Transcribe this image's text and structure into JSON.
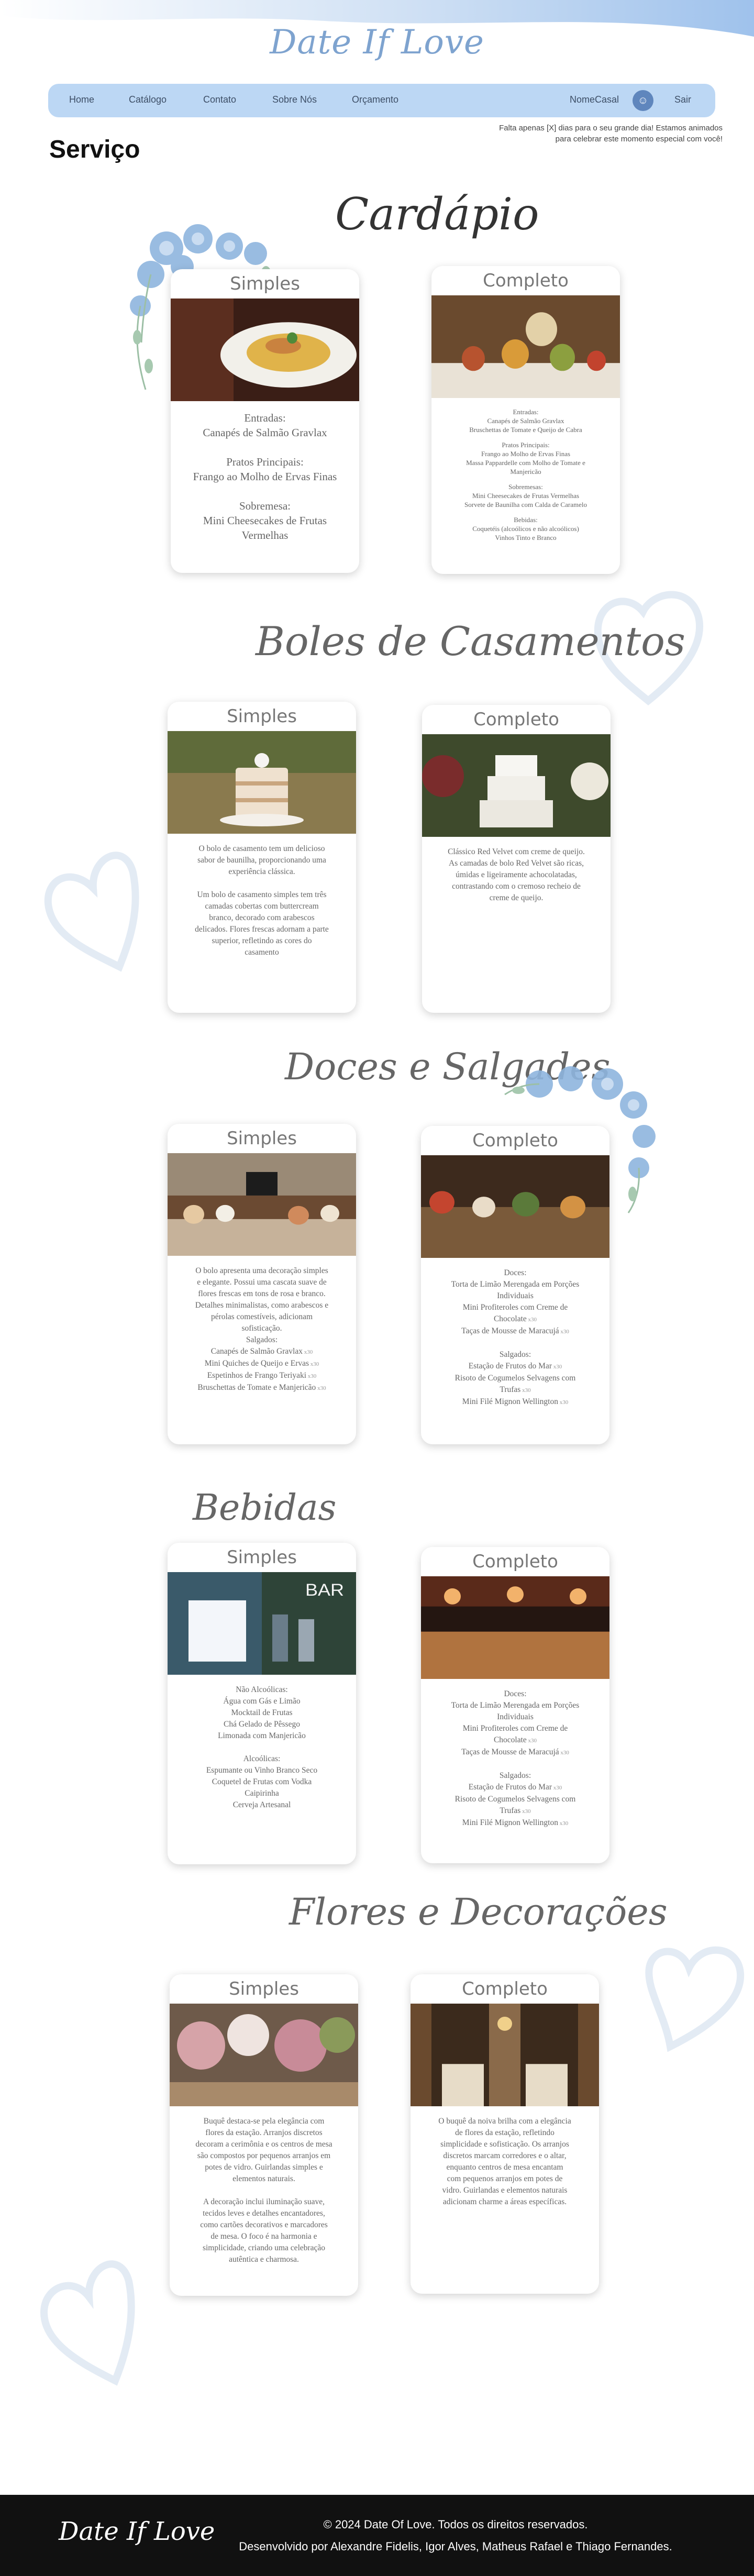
{
  "header": {
    "logo": "Date If Love",
    "nav": [
      "Home",
      "Catálogo",
      "Contato",
      "Sobre Nós",
      "Orçamento"
    ],
    "user_name": "NomeCasal",
    "avatar_icon": "users-icon",
    "logout": "Sair",
    "countdown_line1": "Falta apenas [X] dias para o seu grande dia! Estamos animados",
    "countdown_line2": "para celebrar este momento especial com você!"
  },
  "page_title": "Serviço",
  "sections": {
    "cardapio": {
      "title": "Cardápio",
      "simple": {
        "label": "Simples",
        "lines": [
          "Entradas:",
          "Canapés de Salmão Gravlax",
          "",
          "Pratos Principais:",
          "Frango ao Molho de Ervas Finas",
          "",
          "Sobremesa:",
          "Mini Cheesecakes de Frutas",
          "Vermelhas"
        ]
      },
      "complete": {
        "label": "Completo",
        "lines": [
          "Entradas:",
          "Canapés de Salmão Gravlax",
          "Bruschettas de Tomate e Queijo de Cabra",
          "",
          "Pratos Principais:",
          "Frango ao Molho de Ervas Finas",
          "Massa Pappardelle com Molho de Tomate e",
          "Manjericão",
          "",
          "Sobremesas:",
          "Mini Cheesecakes de Frutas Vermelhas",
          "Sorvete de Baunilha com Calda de Caramelo",
          "",
          "Bebidas:",
          "Coquetéis (alcoólicos e não alcoólicos)",
          "Vinhos Tinto e Branco"
        ]
      }
    },
    "bolos": {
      "title": "Boles de Casamentos",
      "simple": {
        "label": "Simples",
        "lines": [
          "O bolo de casamento tem um delicioso",
          "sabor de baunilha, proporcionando uma",
          "experiência clássica.",
          "",
          "Um bolo de casamento simples tem três",
          "camadas cobertas com buttercream",
          "branco, decorado com arabescos",
          "delicados. Flores frescas adornam a parte",
          "superior, refletindo as cores do",
          "casamento"
        ]
      },
      "complete": {
        "label": "Completo",
        "lines": [
          "Clássico Red Velvet com creme de queijo.",
          "As camadas de bolo Red Velvet são ricas,",
          "úmidas e ligeiramente achocolatadas,",
          "contrastando com o cremoso recheio de",
          "creme de queijo."
        ]
      }
    },
    "doces": {
      "title": "Doces e Salgades",
      "simple": {
        "label": "Simples",
        "lines": [
          "O bolo apresenta uma decoração simples",
          "e elegante. Possui uma cascata suave de",
          "flores frescas em tons de rosa e branco.",
          "Detalhes minimalistas, como arabescos e",
          "pérolas comestíveis, adicionam",
          "sofisticação.",
          "Salgados:"
        ],
        "items": [
          {
            "name": "Canapés de Salmão Gravlax",
            "qty": "x30"
          },
          {
            "name": "Mini Quiches de Queijo e Ervas",
            "qty": "x30"
          },
          {
            "name": "Espetinhos de Frango Teriyaki",
            "qty": "x30"
          },
          {
            "name": "Bruschettas de Tomate e Manjericão",
            "qty": "x30"
          }
        ]
      },
      "complete": {
        "label": "Completo",
        "lines": [
          "Doces:",
          "Torta de Limão Merengada em Porções",
          "Individuais",
          "Mini Profiteroles com Creme de"
        ],
        "items": [
          {
            "name": "Chocolate",
            "qty": "x30"
          },
          {
            "name": "Taças de Mousse de Maracujá",
            "qty": "x30"
          }
        ],
        "heading2": "Salgados:",
        "items2": [
          {
            "name": "Estação de Frutos do Mar",
            "qty": "x30"
          },
          {
            "name": "Risoto de Cogumelos Selvagens com",
            "qty": ""
          },
          {
            "name": "Trufas",
            "qty": "x30"
          },
          {
            "name": "Mini Filé Mignon Wellington",
            "qty": "x30"
          }
        ]
      }
    },
    "bebidas": {
      "title": "Bebidas",
      "simple": {
        "label": "Simples",
        "lines": [
          "Não Alcoólicas:",
          "Água com Gás e Limão",
          "Mocktail de Frutas",
          "Chá Gelado de Pêssego",
          "Limonada com Manjericão",
          "",
          "Alcoólicas:",
          "Espumante ou Vinho Branco Seco",
          "Coquetel de Frutas com Vodka",
          "Caipirinha",
          "Cerveja Artesanal"
        ]
      },
      "complete": {
        "label": "Completo",
        "lines": [
          "Doces:",
          "Torta de Limão Merengada em Porções",
          "Individuais",
          "Mini Profiteroles com Creme de"
        ],
        "items": [
          {
            "name": "Chocolate",
            "qty": "x30"
          },
          {
            "name": "Taças de Mousse de Maracujá",
            "qty": "x30"
          }
        ],
        "heading2": "Salgados:",
        "items2": [
          {
            "name": "Estação de Frutos do Mar",
            "qty": "x30"
          },
          {
            "name": "Risoto de Cogumelos Selvagens com",
            "qty": ""
          },
          {
            "name": "Trufas",
            "qty": "x30"
          },
          {
            "name": "Mini Filé Mignon Wellington",
            "qty": "x30"
          }
        ]
      }
    },
    "flores": {
      "title": "Flores e Decorações",
      "simple": {
        "label": "Simples",
        "lines": [
          "Buquê destaca-se pela elegância com",
          "flores da estação. Arranjos discretos",
          "decoram a cerimônia e os centros de mesa",
          "são compostos por pequenos arranjos em",
          "potes de vidro. Guirlandas simples e",
          "elementos naturais.",
          "",
          "A decoração inclui iluminação suave,",
          "tecidos leves e detalhes encantadores,",
          "como cartões decorativos e marcadores",
          "de mesa. O foco é na harmonia e",
          "simplicidade, criando uma celebração",
          "autêntica e charmosa."
        ]
      },
      "complete": {
        "label": "Completo",
        "lines": [
          "O buquê da noiva brilha com a elegância",
          "de flores da estação, refletindo",
          "simplicidade e sofisticação. Os arranjos",
          "discretos marcam corredores e o altar,",
          "enquanto centros de mesa encantam",
          "com pequenos arranjos em potes de",
          "vidro. Guirlandas e elementos naturais",
          "adicionam charme a áreas específicas."
        ]
      }
    }
  },
  "footer": {
    "logo": "Date If Love",
    "copyright": "© 2024 Date Of Love. Todos os direitos reservados.",
    "credits": "Desenvolvido por Alexandre Fidelis, Igor Alves, Matheus Rafael e Thiago Fernandes."
  },
  "colors": {
    "accent": "#bcd7f4",
    "logo": "#7ea3cf",
    "footer": "#111111"
  }
}
